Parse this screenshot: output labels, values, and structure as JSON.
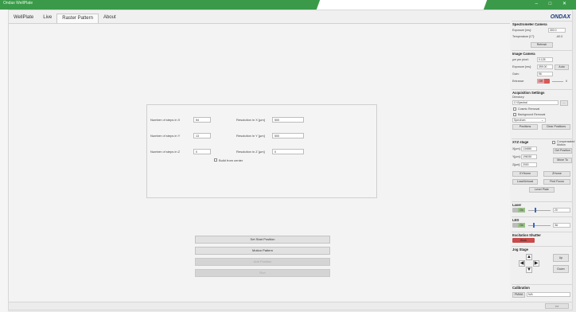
{
  "window": {
    "title": "Ondax WellPlate",
    "controls": "–  □  ✕"
  },
  "tabs": [
    {
      "label": "WellPlate"
    },
    {
      "label": "Live"
    },
    {
      "label": "Raster Pattern"
    },
    {
      "label": "About"
    }
  ],
  "raster": {
    "steps_x_label": "Number of steps in X",
    "steps_x": "54",
    "steps_y_label": "Number of steps in Y",
    "steps_y": "13",
    "steps_z_label": "Number of steps in Z",
    "steps_z": "0",
    "res_x_label": "Resolution in X [µm]",
    "res_x": "500",
    "res_y_label": "Resolution in Y [µm]",
    "res_y": "500",
    "res_z_label": "Resolution in Z [µm]",
    "res_z": "0",
    "build_center_label": "Build from center",
    "set_start": "Set Start Position",
    "motion_pattern": "Motion Pattern",
    "add_position": "Add Position",
    "run": "Run"
  },
  "right": {
    "logo": "ONDAX",
    "spec_cam": {
      "title": "Spectrometer Camera",
      "exposure_label": "Exposure [ms]:",
      "exposure": "300.0",
      "temp_label": "Temperature [C°]:",
      "temp": "-60.0",
      "refresh": "Refresh"
    },
    "img_cam": {
      "title": "Image Camera",
      "umpp_label": "µm per pixel:",
      "umpp": "0.125",
      "exposure_label": "Exposure [ms]:",
      "exposure": "399.00",
      "auto": "Auto",
      "gain_label": "Gain:",
      "gain": "96",
      "entrance_label": "Entrance",
      "entrance_toggle": "Off",
      "entrance_value": "0"
    },
    "acq": {
      "title": "Acquisition Settings",
      "dir_label": "Directory:",
      "dir_value": "C:\\Spectra\\",
      "browse": "...",
      "cosmic": "Cosmic Removal",
      "background": "Background Removal",
      "mode": "Spectrum",
      "positions": "Positions",
      "clear_positions": "Clear Positions"
    },
    "xyz": {
      "title": "XYZ stage",
      "x_label": "X[µm]:",
      "x": "134650",
      "y_label": "Y[µm]:",
      "y": "196030",
      "z_label": "Z[µm]:",
      "z": "2000",
      "compensated": "Compensated Motion",
      "get_position": "Get Position",
      "move_to": "Move To",
      "xyhome": "XYHome",
      "zhome": "ZHome",
      "load_unload": "Load/Unload",
      "find_focus": "Find Focus",
      "level_plate": "Level Plate"
    },
    "laser": {
      "title": "Laser",
      "toggle": "On",
      "value": "20",
      "level": 0.3
    },
    "led": {
      "title": "LED",
      "toggle": "On",
      "value": "3A",
      "level": 0.2
    },
    "excitation": {
      "title": "Excitation Shutter",
      "toggle": "Block"
    },
    "jog": {
      "title": "Jog Stage",
      "up": "Up",
      "down": "Down"
    },
    "calibration": {
      "title": "Calibration",
      "value1": "PMMA",
      "value2": "N/A"
    }
  },
  "bottom": {
    "next": ">>"
  }
}
